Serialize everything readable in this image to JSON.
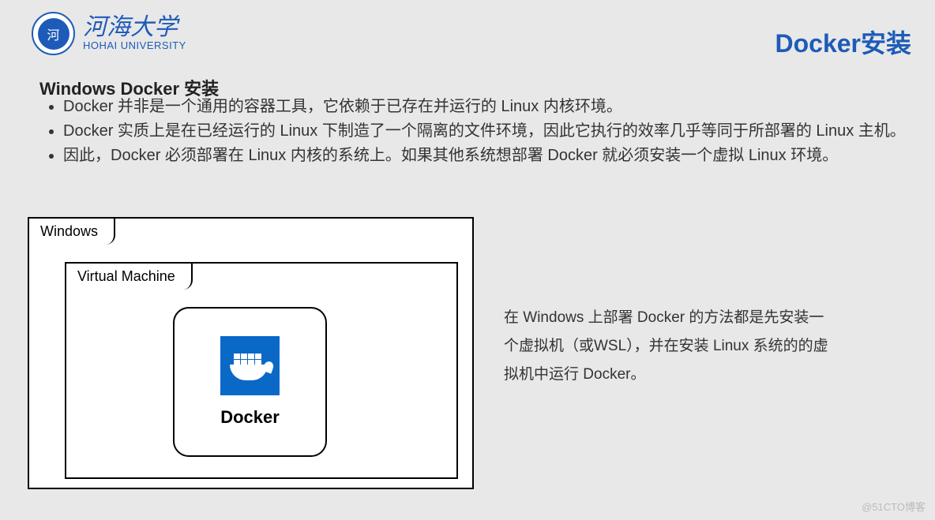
{
  "header": {
    "university_cn": "河海大学",
    "university_en": "HOHAI UNIVERSITY",
    "page_title": "Docker安装"
  },
  "section": {
    "title": "Windows Docker 安装",
    "bullets": [
      "Docker 并非是一个通用的容器工具，它依赖于已存在并运行的 Linux 内核环境。",
      "Docker 实质上是在已经运行的 Linux 下制造了一个隔离的文件环境，因此它执行的效率几乎等同于所部署的 Linux 主机。",
      "因此，Docker 必须部署在 Linux 内核的系统上。如果其他系统想部署 Docker 就必须安装一个虚拟 Linux 环境。"
    ]
  },
  "diagram": {
    "outer_label": "Windows",
    "middle_label": "Virtual Machine",
    "inner_label": "Docker",
    "icon_name": "docker-logo"
  },
  "side_text": "在 Windows 上部署 Docker 的方法都是先安装一个虚拟机（或WSL），并在安装 Linux 系统的的虚拟机中运行 Docker。",
  "watermark": "@51CTO博客"
}
